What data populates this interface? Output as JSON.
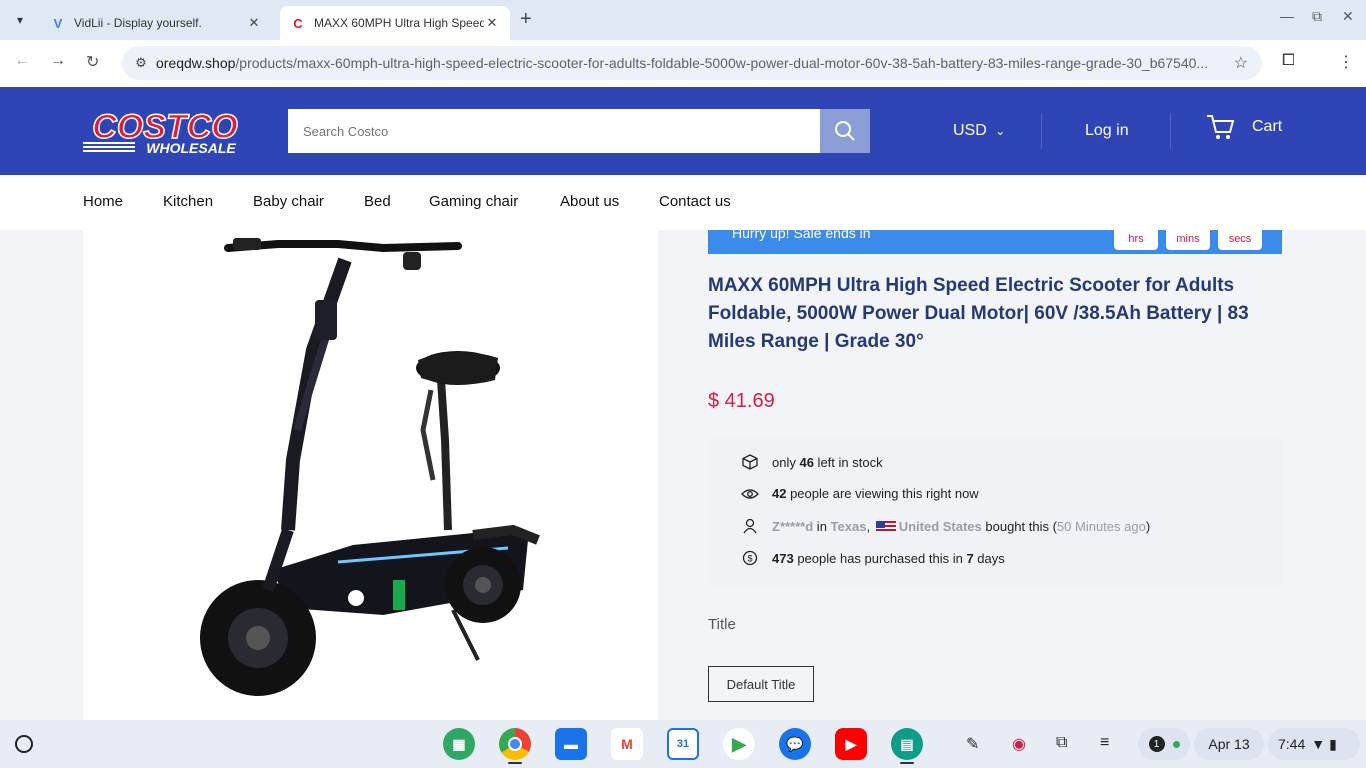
{
  "browser": {
    "tabs": [
      {
        "title": "VidLii - Display yourself.",
        "favicon": "vidlii-icon"
      },
      {
        "title": "MAXX 60MPH Ultra High Speed",
        "favicon": "costco-c-icon"
      }
    ],
    "url_host": "oreqdw.shop",
    "url_path": "/products/maxx-60mph-ultra-high-speed-electric-scooter-for-adults-foldable-5000w-power-dual-motor-60v-38-5ah-battery-83-miles-range-grade-30_b67540..."
  },
  "header": {
    "logo_text_top": "COSTCO",
    "logo_text_bottom": "WHOLESALE",
    "search_placeholder": "Search Costco",
    "currency": "USD",
    "login": "Log in",
    "cart": "Cart",
    "colors": {
      "header_bg": "#3045b5",
      "logo_red": "#e31837",
      "search_button": "#8c9ed6"
    }
  },
  "nav": {
    "items": [
      "Home",
      "Kitchen",
      "Baby chair",
      "Bed",
      "Gaming chair",
      "About us",
      "Contact us"
    ]
  },
  "timer": {
    "text": "Hurry up! Sale ends in",
    "hrs": "hrs",
    "mins": "mins",
    "secs": "secs"
  },
  "product": {
    "title": "MAXX 60MPH Ultra High Speed Electric Scooter for Adults Foldable, 5000W Power Dual Motor| 60V /38.5Ah Battery | 83 Miles Range | Grade 30°",
    "price": "$ 41.69",
    "price_color": "#d21e45"
  },
  "info": {
    "stock_pre": "only ",
    "stock_count": "46",
    "stock_post": " left in stock",
    "viewing_count": "42",
    "viewing_text": " people are viewing this right now",
    "buyer_name": "Z*****d",
    "buyer_in": " in ",
    "buyer_state": "Texas",
    "buyer_comma": ",",
    "buyer_country": "United States",
    "buyer_bought": " bought this (",
    "buyer_time": "50 Minutes ago",
    "buyer_close": ")",
    "purchased_count": "473",
    "purchased_text": " people has purchased this in ",
    "purchased_days": "7",
    "purchased_days_label": " days"
  },
  "variant": {
    "label": "Title",
    "option": "Default Title"
  },
  "taskbar": {
    "date": "Apr 13",
    "time": "7:44",
    "notification_count": "1",
    "calendar_day": "31"
  }
}
